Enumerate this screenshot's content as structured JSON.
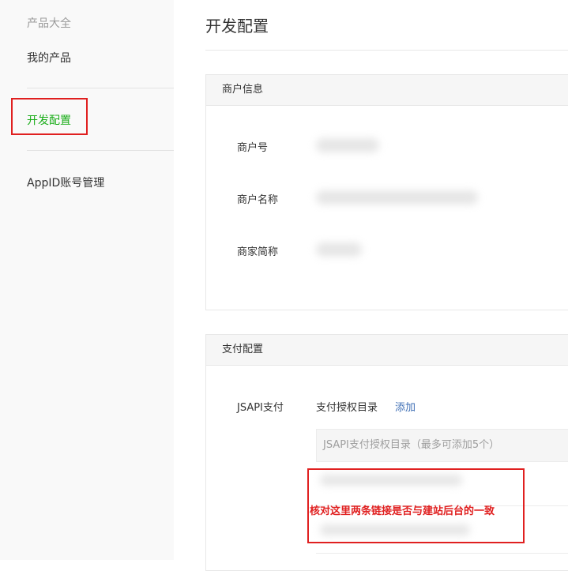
{
  "sidebar": {
    "group_label": "产品大全",
    "items": [
      {
        "label": "我的产品"
      },
      {
        "label": "开发配置"
      },
      {
        "label": "AppID账号管理"
      }
    ]
  },
  "main": {
    "title": "开发配置",
    "merchant_panel": {
      "title": "商户信息",
      "fields": [
        {
          "label": "商户号"
        },
        {
          "label": "商户名称"
        },
        {
          "label": "商家简称"
        }
      ]
    },
    "payment_panel": {
      "title": "支付配置",
      "jsapi_label": "JSAPI支付",
      "auth_dir_label": "支付授权目录",
      "add_link": "添加",
      "input_placeholder": "JSAPI支付授权目录（最多可添加5个）"
    }
  },
  "annotation": {
    "note": "核对这里两条链接是否与建站后台的一致"
  },
  "colors": {
    "active_green": "#1aad19",
    "annotation_red": "#e02020",
    "link_blue": "#3f6fb5"
  }
}
